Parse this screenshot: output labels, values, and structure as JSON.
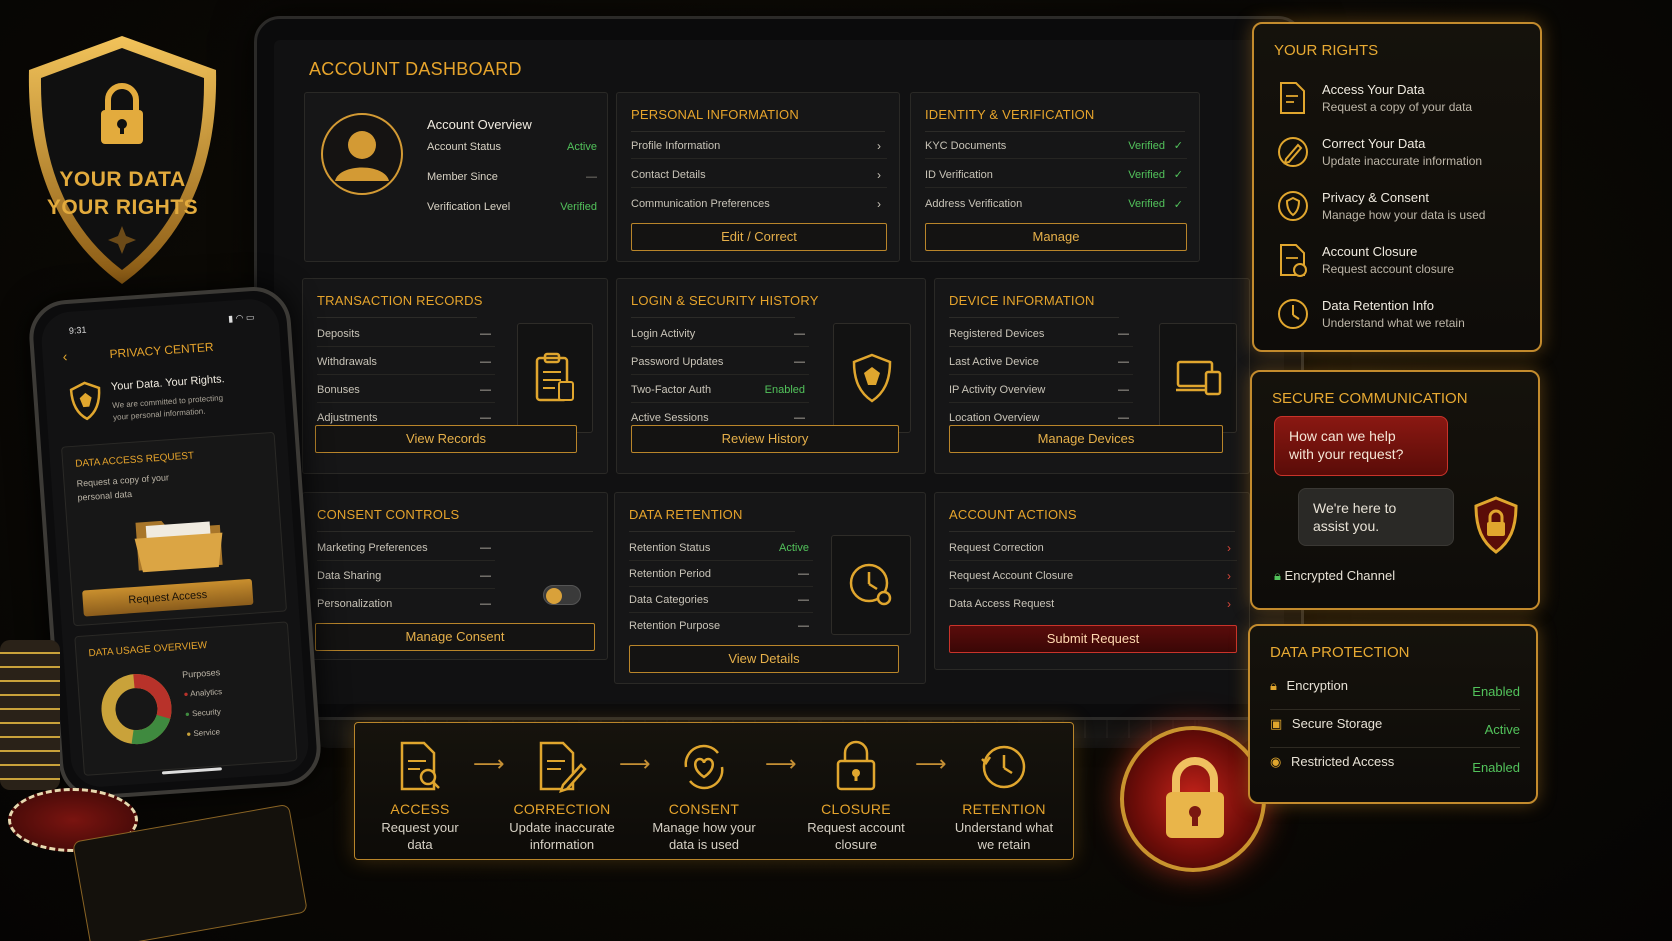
{
  "shield": {
    "line1": "YOUR DATA",
    "line2": "YOUR RIGHTS"
  },
  "dashboard": {
    "title": "ACCOUNT DASHBOARD",
    "overview": {
      "heading": "Account Overview",
      "rows": [
        {
          "label": "Account Status",
          "value": "Active"
        },
        {
          "label": "Member Since",
          "value": "—"
        },
        {
          "label": "Verification Level",
          "value": "Verified"
        }
      ]
    },
    "personal": {
      "title": "PERSONAL INFORMATION",
      "rows": [
        "Profile Information",
        "Contact Details",
        "Communication Preferences"
      ],
      "button": "Edit / Correct"
    },
    "identity": {
      "title": "IDENTITY & VERIFICATION",
      "rows": [
        {
          "label": "KYC Documents",
          "value": "Verified"
        },
        {
          "label": "ID Verification",
          "value": "Verified"
        },
        {
          "label": "Address Verification",
          "value": "Verified"
        }
      ],
      "button": "Manage"
    },
    "transactions": {
      "title": "TRANSACTION RECORDS",
      "rows": [
        {
          "label": "Deposits",
          "value": "—"
        },
        {
          "label": "Withdrawals",
          "value": "—"
        },
        {
          "label": "Bonuses",
          "value": "—"
        },
        {
          "label": "Adjustments",
          "value": "—"
        }
      ],
      "button": "View Records"
    },
    "login": {
      "title": "LOGIN & SECURITY HISTORY",
      "rows": [
        {
          "label": "Login Activity",
          "value": "—"
        },
        {
          "label": "Password Updates",
          "value": "—"
        },
        {
          "label": "Two-Factor Auth",
          "value": "Enabled"
        },
        {
          "label": "Active Sessions",
          "value": "—"
        }
      ],
      "button": "Review History"
    },
    "device": {
      "title": "DEVICE INFORMATION",
      "rows": [
        {
          "label": "Registered Devices",
          "value": "—"
        },
        {
          "label": "Last Active Device",
          "value": "—"
        },
        {
          "label": "IP Activity Overview",
          "value": "—"
        },
        {
          "label": "Location Overview",
          "value": "—"
        }
      ],
      "button": "Manage Devices"
    },
    "consent": {
      "title": "CONSENT CONTROLS",
      "rows": [
        {
          "label": "Marketing Preferences",
          "value": "—"
        },
        {
          "label": "Data Sharing",
          "value": "—"
        },
        {
          "label": "Personalization",
          "value": "—"
        }
      ],
      "button": "Manage Consent"
    },
    "retention": {
      "title": "DATA RETENTION",
      "rows": [
        {
          "label": "Retention Status",
          "value": "Active"
        },
        {
          "label": "Retention Period",
          "value": "—"
        },
        {
          "label": "Data Categories",
          "value": "—"
        },
        {
          "label": "Retention Purpose",
          "value": "—"
        }
      ],
      "button": "View Details"
    },
    "actions": {
      "title": "ACCOUNT ACTIONS",
      "rows": [
        "Request Correction",
        "Request Account Closure",
        "Data Access Request"
      ],
      "button": "Submit Request"
    }
  },
  "phone": {
    "time": "9:31",
    "status_icons": "▮ ◠ ▭",
    "title": "PRIVACY CENTER",
    "intro_title": "Your Data. Your Rights.",
    "intro_line1": "We are committed to protecting",
    "intro_line2": "your personal information.",
    "access_title": "DATA ACCESS REQUEST",
    "access_line1": "Request a copy of your",
    "access_line2": "personal data",
    "access_button": "Request Access",
    "usage_title": "DATA USAGE OVERVIEW",
    "purposes_label": "Purposes",
    "purposes": [
      "Analytics",
      "Security",
      "Service"
    ]
  },
  "rights": {
    "title": "YOUR RIGHTS",
    "items": [
      {
        "title": "Access Your Data",
        "sub": "Request a copy of your data"
      },
      {
        "title": "Correct Your Data",
        "sub": "Update inaccurate information"
      },
      {
        "title": "Privacy & Consent",
        "sub": "Manage how your data is used"
      },
      {
        "title": "Account Closure",
        "sub": "Request account closure"
      },
      {
        "title": "Data Retention Info",
        "sub": "Understand what we retain"
      }
    ]
  },
  "secure": {
    "title": "SECURE COMMUNICATION",
    "bubble1_l1": "How can we help",
    "bubble1_l2": "with your request?",
    "bubble2_l1": "We're here to",
    "bubble2_l2": "assist you.",
    "channel": "Encrypted Channel"
  },
  "protection": {
    "title": "DATA PROTECTION",
    "rows": [
      {
        "label": "Encryption",
        "value": "Enabled"
      },
      {
        "label": "Secure Storage",
        "value": "Active"
      },
      {
        "label": "Restricted Access",
        "value": "Enabled"
      }
    ]
  },
  "flow": [
    {
      "label": "ACCESS",
      "desc1": "Request your",
      "desc2": "data"
    },
    {
      "label": "CORRECTION",
      "desc1": "Update inaccurate",
      "desc2": "information"
    },
    {
      "label": "CONSENT",
      "desc1": "Manage how your",
      "desc2": "data is used"
    },
    {
      "label": "CLOSURE",
      "desc1": "Request account",
      "desc2": "closure"
    },
    {
      "label": "RETENTION",
      "desc1": "Understand what",
      "desc2": "we retain"
    }
  ],
  "colors": {
    "gold": "#e6a42c",
    "green": "#52c25b",
    "red": "#c9332a",
    "bg": "#0b0905"
  }
}
